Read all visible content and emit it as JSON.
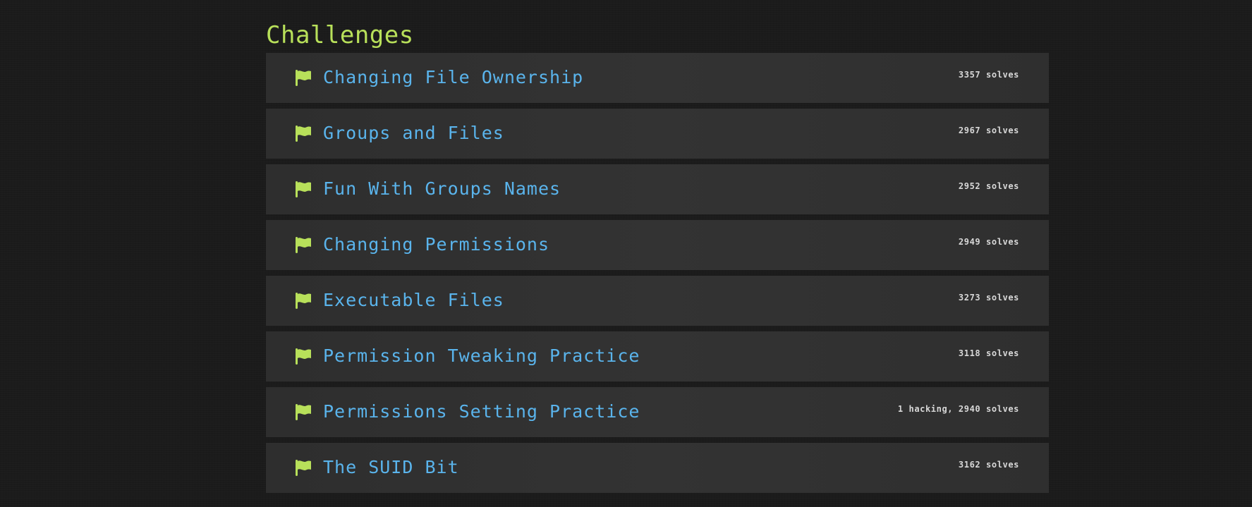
{
  "page": {
    "title": "Challenges"
  },
  "colors": {
    "background": "#1b1b1b",
    "row_background": "#333333",
    "title": "#b8e05a",
    "challenge_name": "#5ab4ec",
    "flag": "#b8e05a",
    "solves_text": "#d8d8d8"
  },
  "challenges": [
    {
      "icon": "flag-icon",
      "name": "Changing File Ownership",
      "solves": "3357 solves"
    },
    {
      "icon": "flag-icon",
      "name": "Groups and Files",
      "solves": "2967 solves"
    },
    {
      "icon": "flag-icon",
      "name": "Fun With Groups Names",
      "solves": "2952 solves"
    },
    {
      "icon": "flag-icon",
      "name": "Changing Permissions",
      "solves": "2949 solves"
    },
    {
      "icon": "flag-icon",
      "name": "Executable Files",
      "solves": "3273 solves"
    },
    {
      "icon": "flag-icon",
      "name": "Permission Tweaking Practice",
      "solves": "3118 solves"
    },
    {
      "icon": "flag-icon",
      "name": "Permissions Setting Practice",
      "solves": "1 hacking, 2940 solves"
    },
    {
      "icon": "flag-icon",
      "name": "The SUID Bit",
      "solves": "3162 solves"
    }
  ]
}
